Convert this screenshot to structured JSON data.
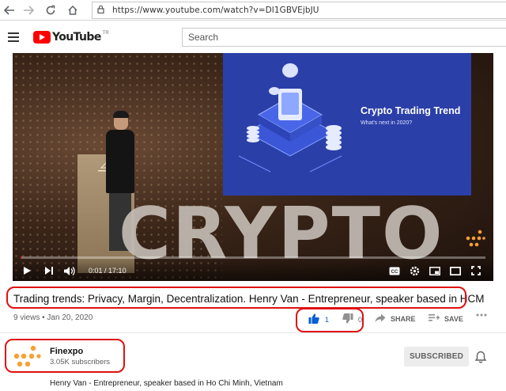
{
  "browser": {
    "url": "https://www.youtube.com/watch?v=Dl1GBVEjbJU"
  },
  "masthead": {
    "logo_text": "YouTube",
    "logo_superscript": "TR",
    "search_placeholder": "Search"
  },
  "player": {
    "slide_title": "Crypto Trading Trend",
    "slide_subtitle": "What's next in 2020?",
    "stage_text": "CRYPTO",
    "current_time": "0:01",
    "duration": "17:10",
    "progress_fraction": 0.001
  },
  "video": {
    "title": "Trading trends: Privacy, Margin, Decentralization. Henry Van - Entrepreneur, speaker based in HCM",
    "views": "9 views",
    "date": "Jan 20, 2020",
    "likes": "1",
    "dislikes": "0",
    "share_label": "SHARE",
    "save_label": "SAVE"
  },
  "channel": {
    "name": "Finexpo",
    "subscribers": "3.05K subscribers",
    "subscribe_label": "SUBSCRIBED"
  },
  "description": "Henry Van - Entrepreneur, speaker based in Ho Chi Minh, Vietnam",
  "colors": {
    "youtube_red": "#ff0000",
    "annotation_red": "#e01010",
    "like_blue": "#065fd4",
    "finexpo_orange": "#f7a033"
  }
}
